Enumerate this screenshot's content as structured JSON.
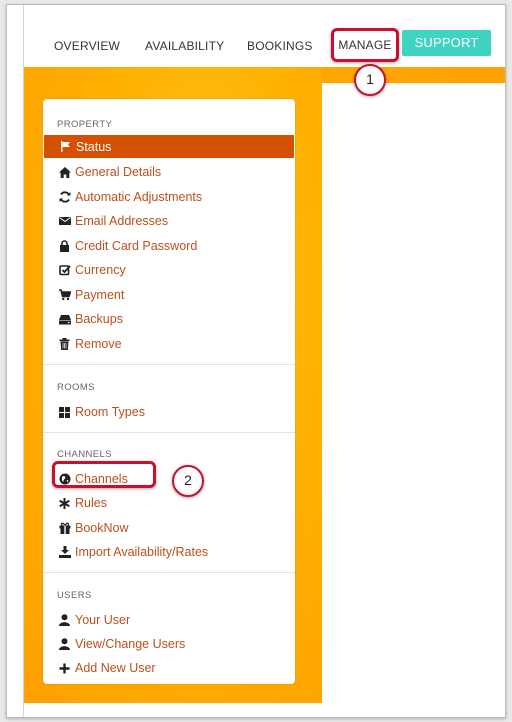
{
  "nav": {
    "overview": "OVERVIEW",
    "availability": "AVAILABILITY",
    "bookings": "BOOKINGS",
    "manage": "MANAGE",
    "support": "SUPPORT"
  },
  "callouts": {
    "one": "1",
    "two": "2"
  },
  "sidebar": {
    "property": {
      "heading": "PROPERTY",
      "items": [
        {
          "label": "Status",
          "icon": "flag-icon",
          "active": true
        },
        {
          "label": "General Details",
          "icon": "home-icon"
        },
        {
          "label": "Automatic Adjustments",
          "icon": "refresh-icon"
        },
        {
          "label": "Email Addresses",
          "icon": "envelope-icon"
        },
        {
          "label": "Credit Card Password",
          "icon": "lock-icon"
        },
        {
          "label": "Currency",
          "icon": "edit-check-icon"
        },
        {
          "label": "Payment",
          "icon": "cart-icon"
        },
        {
          "label": "Backups",
          "icon": "hdd-icon"
        },
        {
          "label": "Remove",
          "icon": "trash-icon"
        }
      ]
    },
    "rooms": {
      "heading": "ROOMS",
      "items": [
        {
          "label": "Room Types",
          "icon": "grid-icon"
        }
      ]
    },
    "channels": {
      "heading": "CHANNELS",
      "items": [
        {
          "label": "Channels",
          "icon": "globe-icon"
        },
        {
          "label": "Rules",
          "icon": "asterisk-icon"
        },
        {
          "label": "BookNow",
          "icon": "gift-icon"
        },
        {
          "label": "Import Availability/Rates",
          "icon": "download-icon"
        }
      ]
    },
    "users": {
      "heading": "USERS",
      "items": [
        {
          "label": "Your User",
          "icon": "user-icon"
        },
        {
          "label": "View/Change Users",
          "icon": "user-icon"
        },
        {
          "label": "Add New User",
          "icon": "plus-icon"
        }
      ]
    }
  },
  "colors": {
    "accent": "#d55000",
    "link": "#b8511d",
    "support": "#3fd3c1",
    "highlight": "#c8102e",
    "banner": "#ffb200"
  }
}
